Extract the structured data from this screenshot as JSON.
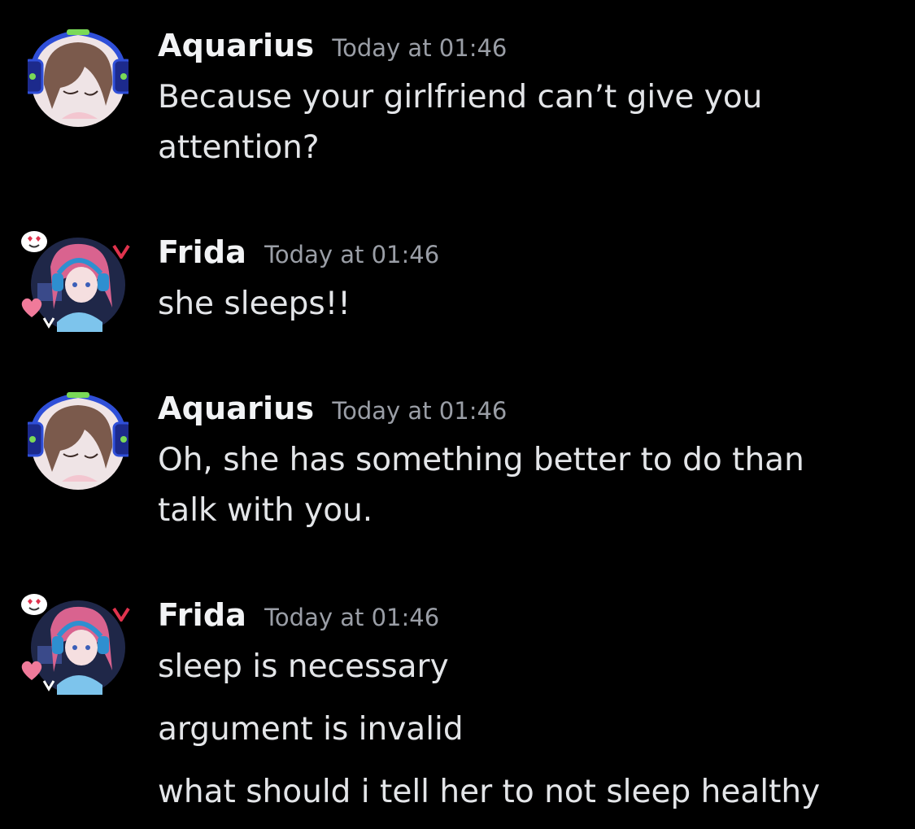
{
  "messages": [
    {
      "author": "Aquarius",
      "timestamp": "Today at 01:46",
      "lines": [
        "Because your girlfriend can’t give you",
        "attention?"
      ]
    },
    {
      "author": "Frida",
      "timestamp": "Today at 01:46",
      "lines": [
        "she sleeps!!"
      ]
    },
    {
      "author": "Aquarius",
      "timestamp": "Today at 01:46",
      "lines": [
        "Oh, she has something better to do than",
        "talk with you."
      ]
    },
    {
      "author": "Frida",
      "timestamp": "Today at 01:46",
      "lines": [
        "sleep is necessary",
        "argument is invalid",
        "what should i tell her to not sleep healthy"
      ]
    }
  ],
  "avatars": {
    "aquarius_icon": "anime-girl-headphones-avatar",
    "frida_icon": "anime-girl-pink-hair-avatar",
    "frame_color": "#2f4fd8",
    "accent_green": "#7ad957",
    "hair_brown": "#7b5a4c",
    "hair_pink": "#d9638f"
  },
  "colors": {
    "background": "#000000",
    "author": "#f2f3f5",
    "timestamp": "#9a9ea6",
    "text": "#e3e5e8"
  }
}
